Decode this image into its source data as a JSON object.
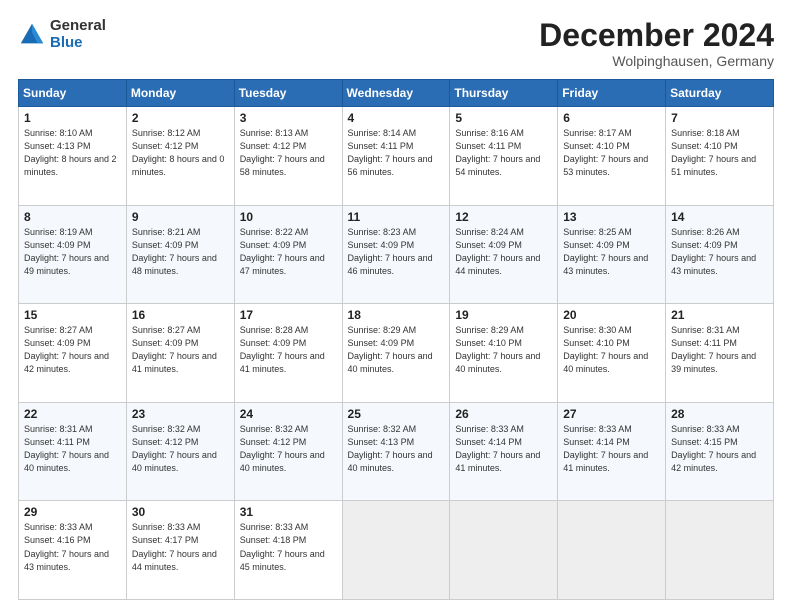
{
  "logo": {
    "general": "General",
    "blue": "Blue"
  },
  "header": {
    "month": "December 2024",
    "location": "Wolpinghausen, Germany"
  },
  "weekdays": [
    "Sunday",
    "Monday",
    "Tuesday",
    "Wednesday",
    "Thursday",
    "Friday",
    "Saturday"
  ],
  "weeks": [
    [
      {
        "day": "1",
        "sunrise": "Sunrise: 8:10 AM",
        "sunset": "Sunset: 4:13 PM",
        "daylight": "Daylight: 8 hours and 2 minutes."
      },
      {
        "day": "2",
        "sunrise": "Sunrise: 8:12 AM",
        "sunset": "Sunset: 4:12 PM",
        "daylight": "Daylight: 8 hours and 0 minutes."
      },
      {
        "day": "3",
        "sunrise": "Sunrise: 8:13 AM",
        "sunset": "Sunset: 4:12 PM",
        "daylight": "Daylight: 7 hours and 58 minutes."
      },
      {
        "day": "4",
        "sunrise": "Sunrise: 8:14 AM",
        "sunset": "Sunset: 4:11 PM",
        "daylight": "Daylight: 7 hours and 56 minutes."
      },
      {
        "day": "5",
        "sunrise": "Sunrise: 8:16 AM",
        "sunset": "Sunset: 4:11 PM",
        "daylight": "Daylight: 7 hours and 54 minutes."
      },
      {
        "day": "6",
        "sunrise": "Sunrise: 8:17 AM",
        "sunset": "Sunset: 4:10 PM",
        "daylight": "Daylight: 7 hours and 53 minutes."
      },
      {
        "day": "7",
        "sunrise": "Sunrise: 8:18 AM",
        "sunset": "Sunset: 4:10 PM",
        "daylight": "Daylight: 7 hours and 51 minutes."
      }
    ],
    [
      {
        "day": "8",
        "sunrise": "Sunrise: 8:19 AM",
        "sunset": "Sunset: 4:09 PM",
        "daylight": "Daylight: 7 hours and 49 minutes."
      },
      {
        "day": "9",
        "sunrise": "Sunrise: 8:21 AM",
        "sunset": "Sunset: 4:09 PM",
        "daylight": "Daylight: 7 hours and 48 minutes."
      },
      {
        "day": "10",
        "sunrise": "Sunrise: 8:22 AM",
        "sunset": "Sunset: 4:09 PM",
        "daylight": "Daylight: 7 hours and 47 minutes."
      },
      {
        "day": "11",
        "sunrise": "Sunrise: 8:23 AM",
        "sunset": "Sunset: 4:09 PM",
        "daylight": "Daylight: 7 hours and 46 minutes."
      },
      {
        "day": "12",
        "sunrise": "Sunrise: 8:24 AM",
        "sunset": "Sunset: 4:09 PM",
        "daylight": "Daylight: 7 hours and 44 minutes."
      },
      {
        "day": "13",
        "sunrise": "Sunrise: 8:25 AM",
        "sunset": "Sunset: 4:09 PM",
        "daylight": "Daylight: 7 hours and 43 minutes."
      },
      {
        "day": "14",
        "sunrise": "Sunrise: 8:26 AM",
        "sunset": "Sunset: 4:09 PM",
        "daylight": "Daylight: 7 hours and 43 minutes."
      }
    ],
    [
      {
        "day": "15",
        "sunrise": "Sunrise: 8:27 AM",
        "sunset": "Sunset: 4:09 PM",
        "daylight": "Daylight: 7 hours and 42 minutes."
      },
      {
        "day": "16",
        "sunrise": "Sunrise: 8:27 AM",
        "sunset": "Sunset: 4:09 PM",
        "daylight": "Daylight: 7 hours and 41 minutes."
      },
      {
        "day": "17",
        "sunrise": "Sunrise: 8:28 AM",
        "sunset": "Sunset: 4:09 PM",
        "daylight": "Daylight: 7 hours and 41 minutes."
      },
      {
        "day": "18",
        "sunrise": "Sunrise: 8:29 AM",
        "sunset": "Sunset: 4:09 PM",
        "daylight": "Daylight: 7 hours and 40 minutes."
      },
      {
        "day": "19",
        "sunrise": "Sunrise: 8:29 AM",
        "sunset": "Sunset: 4:10 PM",
        "daylight": "Daylight: 7 hours and 40 minutes."
      },
      {
        "day": "20",
        "sunrise": "Sunrise: 8:30 AM",
        "sunset": "Sunset: 4:10 PM",
        "daylight": "Daylight: 7 hours and 40 minutes."
      },
      {
        "day": "21",
        "sunrise": "Sunrise: 8:31 AM",
        "sunset": "Sunset: 4:11 PM",
        "daylight": "Daylight: 7 hours and 39 minutes."
      }
    ],
    [
      {
        "day": "22",
        "sunrise": "Sunrise: 8:31 AM",
        "sunset": "Sunset: 4:11 PM",
        "daylight": "Daylight: 7 hours and 40 minutes."
      },
      {
        "day": "23",
        "sunrise": "Sunrise: 8:32 AM",
        "sunset": "Sunset: 4:12 PM",
        "daylight": "Daylight: 7 hours and 40 minutes."
      },
      {
        "day": "24",
        "sunrise": "Sunrise: 8:32 AM",
        "sunset": "Sunset: 4:12 PM",
        "daylight": "Daylight: 7 hours and 40 minutes."
      },
      {
        "day": "25",
        "sunrise": "Sunrise: 8:32 AM",
        "sunset": "Sunset: 4:13 PM",
        "daylight": "Daylight: 7 hours and 40 minutes."
      },
      {
        "day": "26",
        "sunrise": "Sunrise: 8:33 AM",
        "sunset": "Sunset: 4:14 PM",
        "daylight": "Daylight: 7 hours and 41 minutes."
      },
      {
        "day": "27",
        "sunrise": "Sunrise: 8:33 AM",
        "sunset": "Sunset: 4:14 PM",
        "daylight": "Daylight: 7 hours and 41 minutes."
      },
      {
        "day": "28",
        "sunrise": "Sunrise: 8:33 AM",
        "sunset": "Sunset: 4:15 PM",
        "daylight": "Daylight: 7 hours and 42 minutes."
      }
    ],
    [
      {
        "day": "29",
        "sunrise": "Sunrise: 8:33 AM",
        "sunset": "Sunset: 4:16 PM",
        "daylight": "Daylight: 7 hours and 43 minutes."
      },
      {
        "day": "30",
        "sunrise": "Sunrise: 8:33 AM",
        "sunset": "Sunset: 4:17 PM",
        "daylight": "Daylight: 7 hours and 44 minutes."
      },
      {
        "day": "31",
        "sunrise": "Sunrise: 8:33 AM",
        "sunset": "Sunset: 4:18 PM",
        "daylight": "Daylight: 7 hours and 45 minutes."
      },
      null,
      null,
      null,
      null
    ]
  ]
}
